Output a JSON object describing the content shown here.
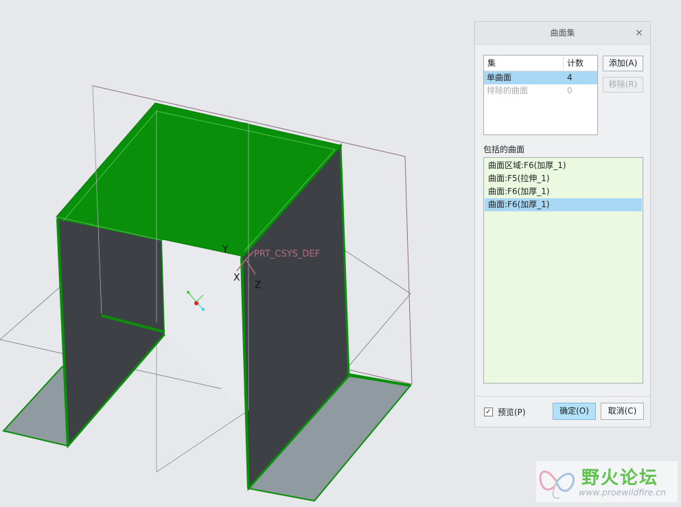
{
  "viewport": {
    "csys_label": "PRT_CSYS_DEF",
    "axis_x": "X",
    "axis_y": "Y",
    "axis_z": "Z"
  },
  "dialog": {
    "title": "曲面集",
    "close_icon": "close-icon",
    "set_table": {
      "headers": [
        "集",
        "计数"
      ],
      "rows": [
        {
          "name": "单曲面",
          "count": "4",
          "selected": true
        },
        {
          "name": "排除的曲面",
          "count": "0",
          "disabled": true
        }
      ]
    },
    "add_label": "添加(A)",
    "remove_label": "移除(R)",
    "included_label": "包括的曲面",
    "included_items": [
      "曲面区域:F6(加厚_1)",
      "曲面:F5(拉伸_1)",
      "曲面:F6(加厚_1)",
      "曲面:F6(加厚_1)"
    ],
    "preview_label": "预览(P)",
    "preview_checked": true,
    "ok_label": "确定(O)",
    "cancel_label": "取消(C)"
  },
  "watermark": {
    "title": "野火论坛",
    "url": "www.proewildfire.cn"
  },
  "colors": {
    "selection_green": "#0a8f0a",
    "wall_dark": "#3d4146",
    "base_gray": "#8f9aa1",
    "list_bg": "#eaf9df",
    "selected_row": "#a9d8f5"
  }
}
